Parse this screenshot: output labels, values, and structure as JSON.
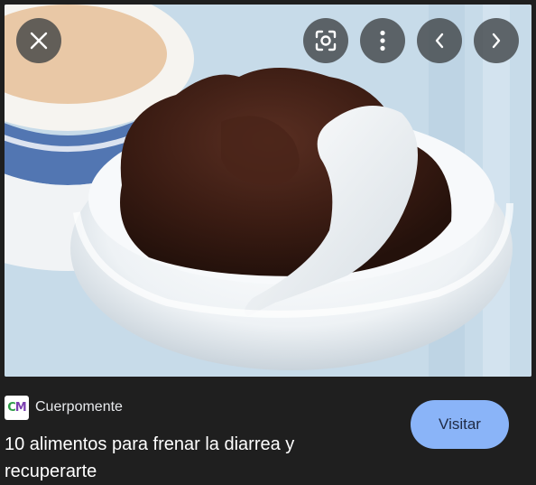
{
  "source": {
    "favicon_letters": "CM",
    "name": "Cuerpomente"
  },
  "result": {
    "title": "10 alimentos para frenar la diarrea y recuperarte"
  },
  "actions": {
    "visit_label": "Visitar"
  },
  "icons": {
    "close": "close-icon",
    "lens": "lens-search-icon",
    "more": "more-vert-icon",
    "prev": "chevron-left-icon",
    "next": "chevron-right-icon"
  },
  "colors": {
    "background": "#1f1f1f",
    "accent_button": "#8ab4f8",
    "overlay_button": "#3c4043"
  }
}
